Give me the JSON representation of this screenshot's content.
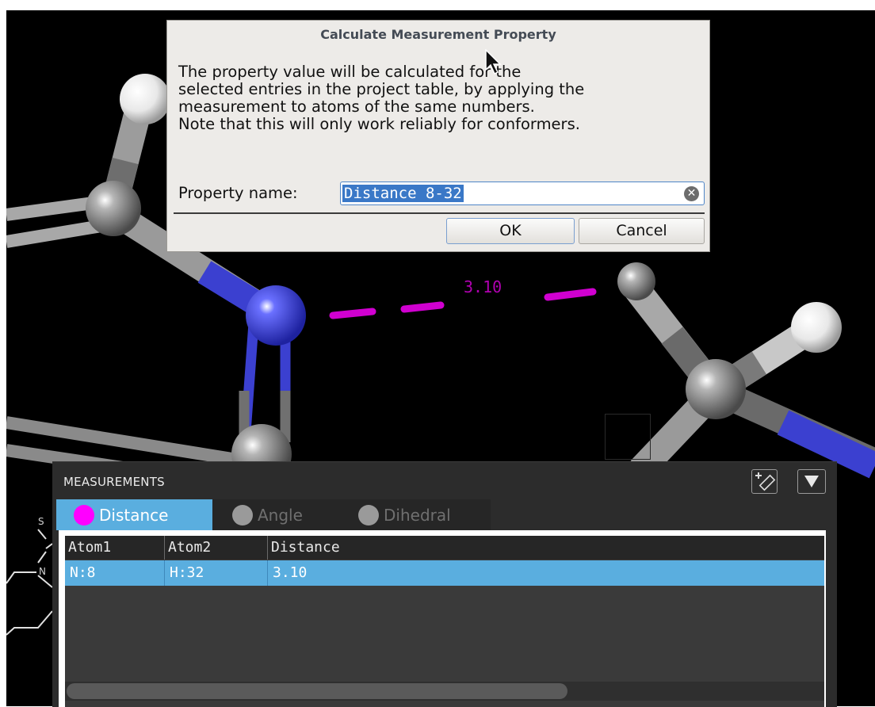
{
  "dialog": {
    "title": "Calculate Measurement Property",
    "message_lines": [
      "The property value will be calculated for the",
      "selected entries in the project table, by applying the",
      "measurement to atoms of the same numbers.",
      "Note that this will only work reliably for conformers."
    ],
    "property_label": "Property name:",
    "property_value": "Distance 8-32",
    "ok_label": "OK",
    "cancel_label": "Cancel"
  },
  "viewport": {
    "distance_label": "3.10",
    "distance_color": "#cc00cc"
  },
  "structure_panel": {
    "atom_labels": [
      "S",
      "N"
    ]
  },
  "measurements": {
    "title": "MEASUREMENTS",
    "tabs": [
      {
        "label": "Distance",
        "selected": true,
        "dot_color": "#ff00ff"
      },
      {
        "label": "Angle",
        "selected": false,
        "dot_color": "#9a9a9a"
      },
      {
        "label": "Dihedral",
        "selected": false,
        "dot_color": "#9a9a9a"
      }
    ],
    "table": {
      "columns": [
        "Atom1",
        "Atom2",
        "Distance"
      ],
      "rows": [
        {
          "atom1": "N:8",
          "atom2": "H:32",
          "distance": "3.10",
          "selected": true
        }
      ]
    },
    "add_measurement_icon": "ruler-add-icon",
    "menu_icon": "triangle-down-icon"
  },
  "colors": {
    "selection": "#5aaedf",
    "nitrogen": "#3a3ed8",
    "carbon": "#808080",
    "hydrogen": "#f0f0f0"
  }
}
